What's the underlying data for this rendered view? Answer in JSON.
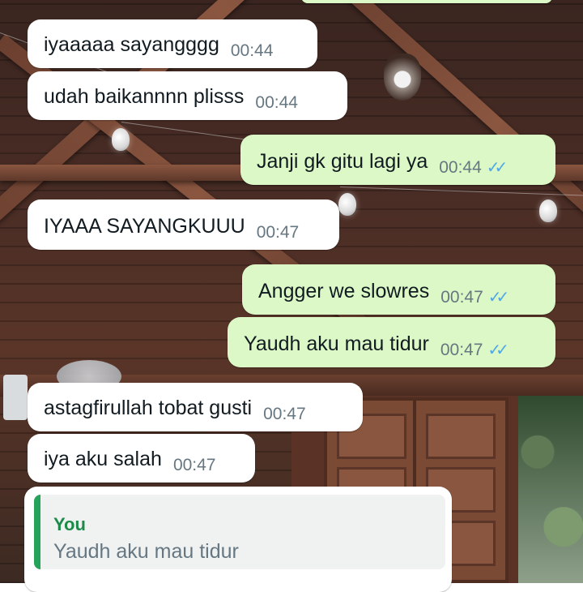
{
  "messages": [
    {
      "direction": "in",
      "text": "iyaaaaa sayangggg",
      "time": "00:44"
    },
    {
      "direction": "in",
      "text": "udah baikannnn plisss",
      "time": "00:44"
    },
    {
      "direction": "out",
      "text": "Janji gk gitu lagi ya",
      "time": "00:44",
      "status": "read"
    },
    {
      "direction": "in",
      "text": "IYAAA SAYANGKUUU",
      "time": "00:47"
    },
    {
      "direction": "out",
      "text": "Angger we slowres",
      "time": "00:47",
      "status": "read"
    },
    {
      "direction": "out",
      "text": "Yaudh aku mau tidur",
      "time": "00:47",
      "status": "read"
    },
    {
      "direction": "in",
      "text": "astagfirullah tobat gusti",
      "time": "00:47"
    },
    {
      "direction": "in",
      "text": "iya aku salah",
      "time": "00:47"
    }
  ],
  "quoted_reply": {
    "author": "You",
    "text": "Yaudh aku mau tidur"
  },
  "icons": {
    "read_receipt": "double-check-icon"
  },
  "colors": {
    "incoming_bubble": "#ffffff",
    "outgoing_bubble": "#dcf8c6",
    "timestamp": "#667781",
    "read_ticks": "#4fa8e8",
    "quote_accent": "#25a35b"
  }
}
